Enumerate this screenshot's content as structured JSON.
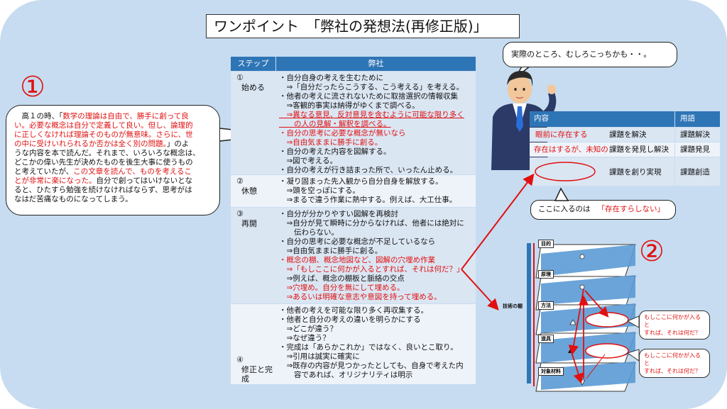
{
  "title": "ワンポイント　「弊社の発想法(再修正版)」",
  "left_number": "①",
  "right_number": "②",
  "left_bubble": {
    "line1": "　高１の時、「",
    "line1_red": "数学の理論は自由で、勝手に創って良",
    "line2_red": "い。必要な概念は自分で定義して良い。但し、論理的",
    "line3_red": "に正しくなければ理論そのものが無意味。さらに、世",
    "line4_red": "の中に受けいれられるか否かは全く別の問題。",
    "line4": "」のよ",
    "line5": "うな内容を本で読んだ。それまで、いろいろな概念は、",
    "line6": "どこかの偉い先生が決めたものを後生大事に使うもの",
    "line7": "と考えていたが、",
    "line7_red": "この文章を読んで、ものを考えるこ",
    "line8_red": "とが非常に楽になった。",
    "line8": "自分で創ってはいけないとな",
    "line9": "ると、ひたすら勉強を続けなければならず、思考がは",
    "line10": "なはだ苦痛なものになってしまう。"
  },
  "table": {
    "header_step": "ステップ",
    "header_company": "弊社",
    "rows": [
      {
        "num": "①",
        "step": "始める",
        "lines": [
          {
            "text": "・自分自身の考えを生むために",
            "style": "n"
          },
          {
            "text": "　⇒「自分だったらこうする、こう考える」を考える。",
            "style": "n"
          },
          {
            "text": "・他者の考えに流されないために取捨選択の情報収集",
            "style": "n"
          },
          {
            "text": "　⇒客観的事実は納得がゆくまで調べる。",
            "style": "n"
          },
          {
            "text": "　⇒異なる意見、反対意見を含むように可能な限り多く",
            "style": "ru"
          },
          {
            "text": "　　の人の見解・解釈を調べる。",
            "style": "ru"
          },
          {
            "text": "・自分の思考に必要な概念が無いなら",
            "style": "r"
          },
          {
            "text": "　⇒自由気ままに勝手に創る。",
            "style": "r"
          },
          {
            "text": "・自分の考えた内容を図解する。",
            "style": "n"
          },
          {
            "text": "　⇒図で考える。",
            "style": "n"
          },
          {
            "text": "・自分の考えが行き詰まった所で、いったん止める。",
            "style": "n"
          }
        ]
      },
      {
        "num": "②",
        "step": "休憩",
        "lines": [
          {
            "text": "・凝り固まった先入観から自分自身を解放する。",
            "style": "n"
          },
          {
            "text": "　⇒頭を空っぽにする。",
            "style": "n"
          },
          {
            "text": "　⇒まるで違う作業に熱中する。例えば、大工仕事。",
            "style": "n"
          }
        ]
      },
      {
        "num": "③",
        "step": "再開",
        "lines": [
          {
            "text": "・自分が分かりやすい図解を再検討",
            "style": "n"
          },
          {
            "text": "　⇒自分が見て瞬時に分からなければ、他者には絶対に",
            "style": "n"
          },
          {
            "text": "　　伝わらない。",
            "style": "n"
          },
          {
            "text": "・自分の思考に必要な概念が不足しているなら",
            "style": "n"
          },
          {
            "text": "　⇒自由気ままに勝手に創る。",
            "style": "n"
          },
          {
            "text": "・概念の棚、概念地図など、図解の穴埋め作業",
            "style": "r"
          },
          {
            "text": "　⇒「もしここに何かが入るとすれば、それは何だ？」",
            "style": "r"
          },
          {
            "text": "　⇒例えば、概念の棚板と脈絡の交点",
            "style": "n"
          },
          {
            "text": "　⇒穴埋め。自分を無にして埋める。",
            "style": "r"
          },
          {
            "text": "　⇒あるいは明確な意志や意図を持って埋める。",
            "style": "r"
          }
        ]
      },
      {
        "num": "④",
        "step": "修正と完成",
        "lines": [
          {
            "text": "・他者の考えを可能な限り多く再収集する。",
            "style": "n"
          },
          {
            "text": "・他者と自分の考えの違いを明らかにする",
            "style": "n"
          },
          {
            "text": "　⇒どこが違う？",
            "style": "n"
          },
          {
            "text": "　⇒なぜ違う？",
            "style": "n"
          },
          {
            "text": "・完成は「あらかこれか」ではなく、良いとこ取り。",
            "style": "n"
          },
          {
            "text": "　⇒引用は誠実に確実に",
            "style": "n"
          },
          {
            "text": "　⇒既存の内容が見つかったとしても、自身で考えた内",
            "style": "n"
          },
          {
            "text": "　　容であれば、オリジナリティは明示",
            "style": "n"
          }
        ]
      }
    ]
  },
  "top_bubble": "実際のところ、むしろこっちかも・・。",
  "right_table": {
    "header_content": "内容",
    "header_term": "用語",
    "rows": [
      {
        "red": "眼前に存在する",
        "black": "課題を解決",
        "term": "課題解決"
      },
      {
        "red": "存在はするが、未知の",
        "black": "課題を発見し解決",
        "term": "課題発見"
      },
      {
        "red": "",
        "black": "課題を創り実現",
        "term": "課題創造"
      }
    ]
  },
  "small_bubble": {
    "text": "ここに入るのは",
    "red": "「存在すらしない」"
  },
  "ladder": {
    "side_label": "技術の棚",
    "shelves": [
      "目的",
      "原理",
      "方法",
      "道具",
      "対象材料"
    ],
    "bubble1": "もしここに何かが入ると\nすれば、それは何だ？",
    "bubble2": "もしここに何かが入ると\nすれば、それは何だ？"
  }
}
